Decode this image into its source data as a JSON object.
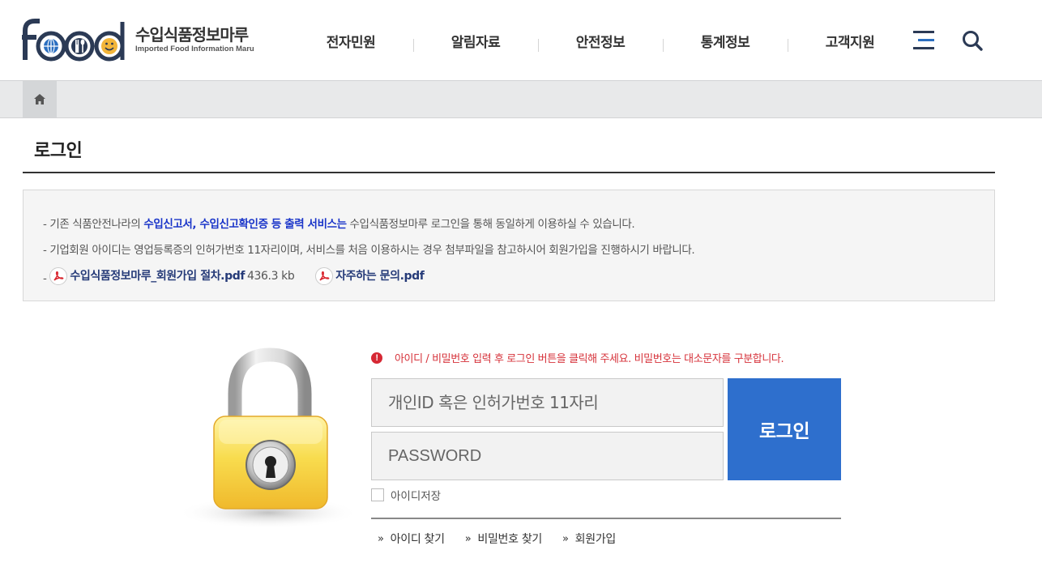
{
  "header": {
    "logo_word": "food",
    "logo_ko": "수입식품정보마루",
    "logo_en": "Imported Food Information Maru",
    "nav": [
      "전자민원",
      "알림자료",
      "안전정보",
      "통계정보",
      "고객지원"
    ],
    "menu_icon": "hamburger-menu-icon",
    "search_icon": "search-icon"
  },
  "breadcrumb": {
    "home_icon": "home-icon"
  },
  "page": {
    "title": "로그인"
  },
  "notice": {
    "line1_prefix": "- 기존 식품안전나라의 ",
    "line1_highlight": "수입신고서, 수입신고확인증 등 출력 서비스는",
    "line1_suffix": " 수입식품정보마루 로그인을 통해 동일하게 이용하실 수 있습니다.",
    "line2": "- 기업회원 아이디는 영업등록증의 인허가번호 11자리이며, 서비스를 처음 이용하시는 경우 첨부파일을 참고하시어 회원가입을 진행하시기 바랍니다.",
    "line3_prefix": "- ",
    "file1_name": "수입식품정보마루_회원가입 절차.pdf",
    "file1_size": "436.3 kb",
    "file2_name": "자주하는 문의.pdf"
  },
  "login": {
    "message": "아이디 / 비밀번호 입력 후 로그인 버튼을 클릭해 주세요. 비밀번호는 대소문자를 구분합니다.",
    "alert_glyph": "!",
    "id_placeholder": "개인ID 혹은 인허가번호 11자리",
    "pw_placeholder": "PASSWORD",
    "button_label": "로그인",
    "save_id_label": "아이디저장",
    "links": [
      "아이디 찾기",
      "비밀번호 찾기",
      "회원가입"
    ],
    "link_chevron": "»"
  },
  "colors": {
    "brand_navy": "#2b3a55",
    "login_button": "#2e6fcd",
    "highlight": "#1a35c9",
    "alert": "#d62834"
  }
}
